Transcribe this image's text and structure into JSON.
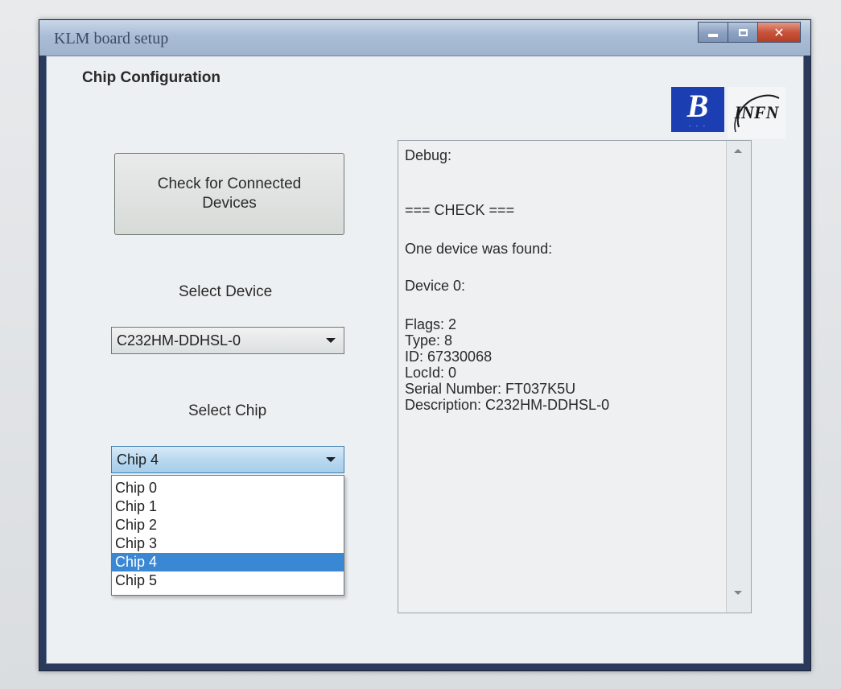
{
  "window": {
    "title": "KLM board setup"
  },
  "panel": {
    "title": "Chip Configuration"
  },
  "logos": {
    "left_logo": "B",
    "right_logo": "INFN",
    "left_logo_color": "#1b3fb3"
  },
  "check_button": {
    "label": "Check for Connected Devices"
  },
  "select_device": {
    "label": "Select Device",
    "value": "C232HM-DDHSL-0"
  },
  "select_chip": {
    "label": "Select Chip",
    "value": "Chip 4",
    "options": [
      "Chip 0",
      "Chip 1",
      "Chip 2",
      "Chip 3",
      "Chip 4",
      "Chip 5"
    ],
    "highlighted_index": 4
  },
  "debug": {
    "lines": [
      "Debug:",
      "=== CHECK ===",
      "One device was found:",
      "Device 0:",
      "Flags: 2",
      "Type: 8",
      "ID: 67330068",
      "LocId: 0",
      "Serial Number: FT037K5U",
      "Description: C232HM-DDHSL-0"
    ]
  },
  "colors": {
    "selection": "#3a88d4",
    "close_button": "#c9543a"
  }
}
